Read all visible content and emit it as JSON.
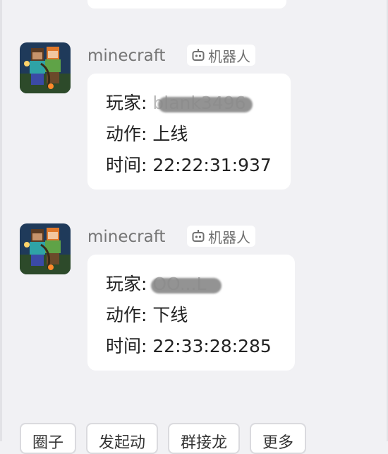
{
  "messages": [
    {
      "sender": "minecraft",
      "badge": "机器人",
      "player_label": "玩家: ",
      "player_value": "blank3496",
      "action_line": "动作: 上线",
      "time_line": "时间: 22:22:31:937"
    },
    {
      "sender": "minecraft",
      "badge": "机器人",
      "player_label": "玩家: ",
      "player_value": "OO...L",
      "action_line": "动作: 下线",
      "time_line": "时间: 22:33:28:285"
    }
  ],
  "bottom_bar": [
    "圈子",
    "发起动",
    "群接龙",
    "更多"
  ],
  "icons": {
    "avatar": "minecraft-avatar-icon",
    "badge": "robot-icon"
  },
  "colors": {
    "background": "#f1f1f4",
    "bubble": "#ffffff",
    "text": "#222222",
    "muted": "#757575"
  }
}
